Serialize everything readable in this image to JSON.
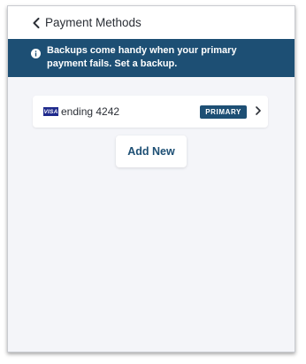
{
  "header": {
    "title": "Payment Methods",
    "back_icon": "chevron-left-icon"
  },
  "banner": {
    "icon": "info-icon",
    "message": "Backups come handy when your primary payment fails. Set a backup.",
    "background_color": "#1d4f74"
  },
  "payment_methods": [
    {
      "brand_icon": "visa-card-icon",
      "brand_text": "VISA",
      "label": "ending 4242",
      "badge": "PRIMARY",
      "chevron_icon": "chevron-right-icon"
    }
  ],
  "actions": {
    "add_new_label": "Add New"
  },
  "colors": {
    "accent": "#1d4f74",
    "page_background": "#f4f5f9",
    "visa_blue": "#1f2a8c"
  }
}
